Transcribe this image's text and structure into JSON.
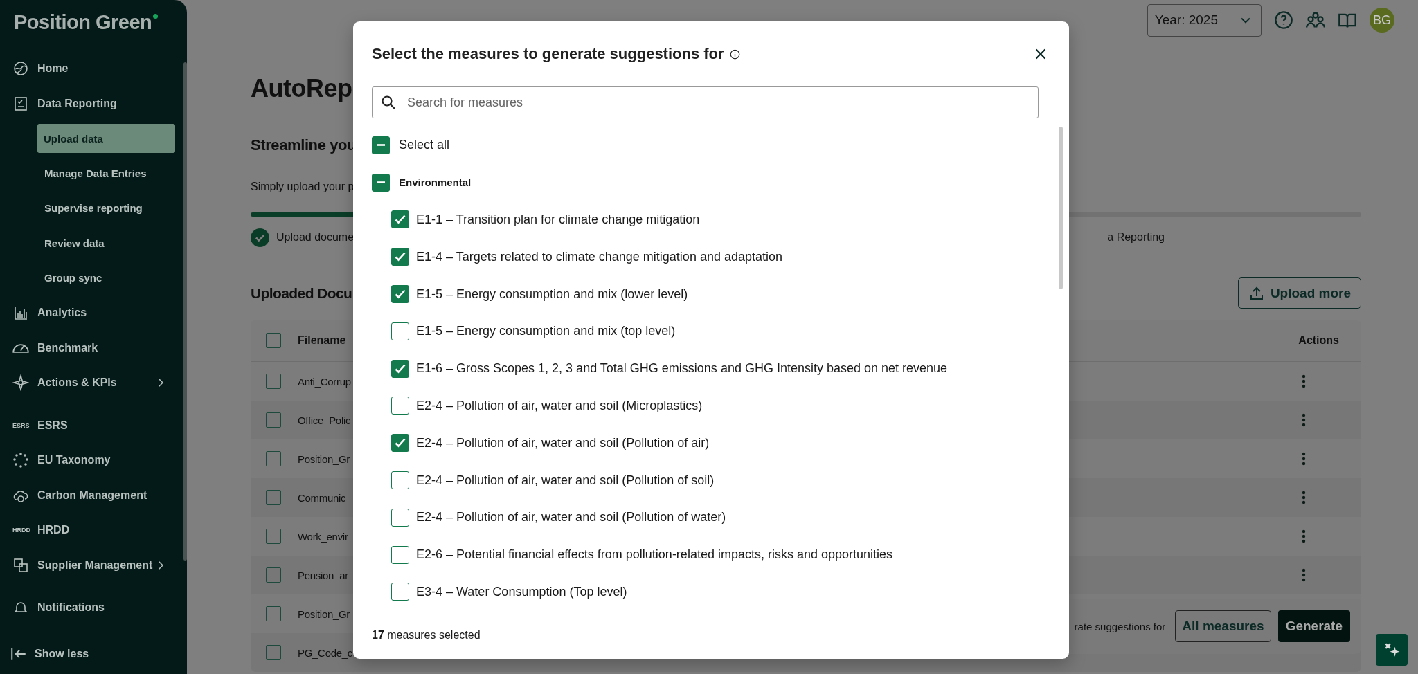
{
  "sidebar": {
    "logo": "Position Green",
    "items": [
      {
        "label": "Home",
        "selected": false
      },
      {
        "label": "Data Reporting",
        "selected": false,
        "children": [
          {
            "label": "Upload data",
            "selected": true
          },
          {
            "label": "Manage Data Entries",
            "selected": false
          },
          {
            "label": "Supervise reporting",
            "selected": false
          },
          {
            "label": "Review data",
            "selected": false
          },
          {
            "label": "Group sync",
            "selected": false
          }
        ]
      },
      {
        "label": "Analytics",
        "selected": false
      },
      {
        "label": "Benchmark",
        "selected": false
      },
      {
        "label": "Actions & KPIs",
        "selected": false,
        "chevron": true
      }
    ],
    "items2": [
      {
        "label": "ESRS",
        "badge": "ESRS",
        "selected": false
      },
      {
        "label": "EU Taxonomy",
        "selected": false
      },
      {
        "label": "Carbon Management",
        "selected": false
      },
      {
        "label": "HRDD",
        "badge": "HRDD",
        "selected": false
      },
      {
        "label": "Supplier Management",
        "selected": false,
        "chevron": true
      }
    ],
    "cut_item": "Notifications",
    "show_less": "Show less"
  },
  "header": {
    "year": "Year: 2025",
    "avatar": "BG"
  },
  "page": {
    "title": "AutoRep",
    "subtitle": "Streamline you",
    "intro": "Simply upload your p",
    "progress": {
      "level": 0.3
    },
    "step_left": "Upload docume",
    "step_right": "a Reporting",
    "section": "Uploaded Docu",
    "upload_button": "Upload more",
    "table": {
      "columns": [
        "Filename",
        "Actions"
      ],
      "header_checked": false,
      "rows": [
        {
          "filename": "Anti_Corrup",
          "checked": false
        },
        {
          "filename": "Office_Polic",
          "checked": false
        },
        {
          "filename": "Position_Gr",
          "checked": false
        },
        {
          "filename": "Communic",
          "checked": false
        },
        {
          "filename": "Work_envir",
          "checked": false
        },
        {
          "filename": "Pension_ar",
          "checked": false
        },
        {
          "filename": "Position_Gr",
          "checked": false
        },
        {
          "filename": "PG_Code_c",
          "checked": false
        }
      ]
    },
    "bottom_bar": {
      "text": "rate suggestions for",
      "scope_button": "All measures",
      "generate_button": "Generate"
    }
  },
  "modal": {
    "title": "Select the measures to generate suggestions for",
    "search_placeholder": "Search for measures",
    "select_all": {
      "label": "Select all",
      "checked": true,
      "indeterminate": true
    },
    "group": {
      "label": "Environmental",
      "checked": true,
      "indeterminate": true
    },
    "measures": [
      {
        "label": "E1-1 – Transition plan for climate change mitigation",
        "checked": true
      },
      {
        "label": "E1-4 – Targets related to climate change mitigation and adaptation",
        "checked": true
      },
      {
        "label": "E1-5 – Energy consumption and mix (lower level)",
        "checked": true
      },
      {
        "label": "E1-5 – Energy consumption and mix (top level)",
        "checked": false
      },
      {
        "label": "E1-6 – Gross Scopes 1, 2, 3 and Total GHG emissions and GHG Intensity based on net revenue",
        "checked": true
      },
      {
        "label": "E2-4 – Pollution of air, water and soil (Microplastics)",
        "checked": false
      },
      {
        "label": "E2-4 – Pollution of air, water and soil (Pollution of air)",
        "checked": true
      },
      {
        "label": "E2-4 – Pollution of air, water and soil (Pollution of soil)",
        "checked": false
      },
      {
        "label": "E2-4 – Pollution of air, water and soil (Pollution of water)",
        "checked": false
      },
      {
        "label": "E2-6 – Potential financial effects from pollution-related impacts, risks and opportunities",
        "checked": false
      },
      {
        "label": "E3-4 – Water Consumption (Top level)",
        "checked": false
      }
    ],
    "footer": "**17** measures selected"
  }
}
